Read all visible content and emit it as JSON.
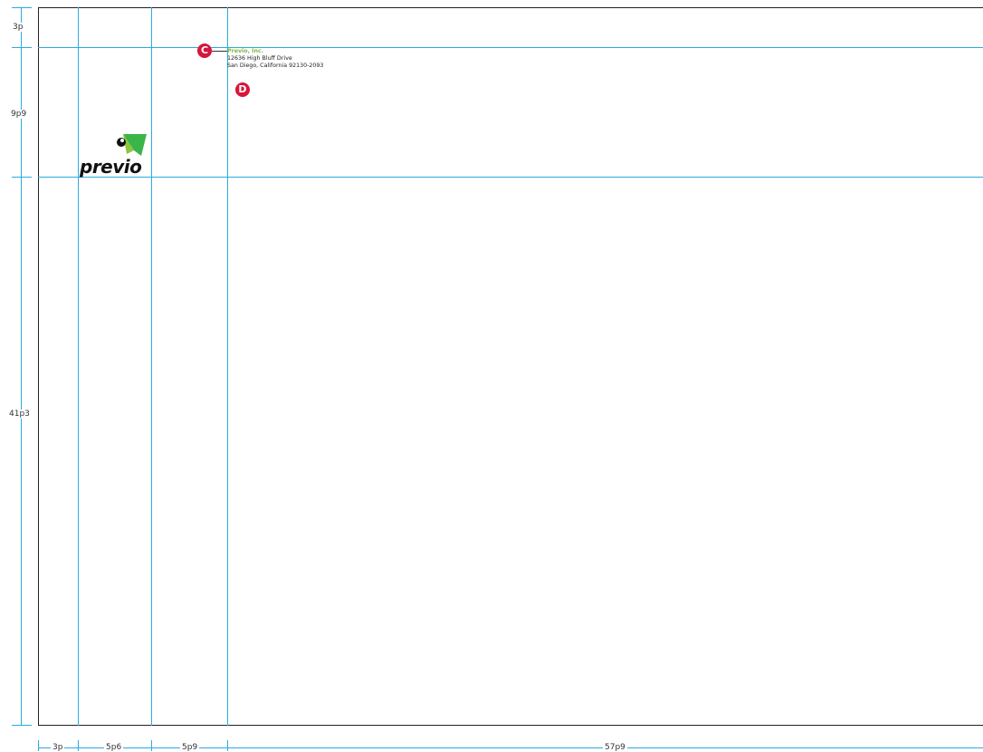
{
  "address_block": {
    "company": "Previo, Inc.",
    "street": "12636 High Bluff Drive",
    "city": "San Diego, California 92130-2093"
  },
  "markers": {
    "c": "C",
    "d": "D"
  },
  "logo": {
    "wordmark": "previo",
    "tagline": ""
  },
  "dimensions": {
    "vertical": [
      "3p",
      "9p9",
      "41p3"
    ],
    "horizontal": [
      "3p",
      "5p6",
      "5p9",
      "57p9"
    ]
  },
  "colors": {
    "guide": "#29abe2",
    "marker": "#d6163a",
    "brand_green": "#7ab841",
    "logo_green_light": "#8dc63f",
    "logo_green_dark": "#39b54a"
  }
}
